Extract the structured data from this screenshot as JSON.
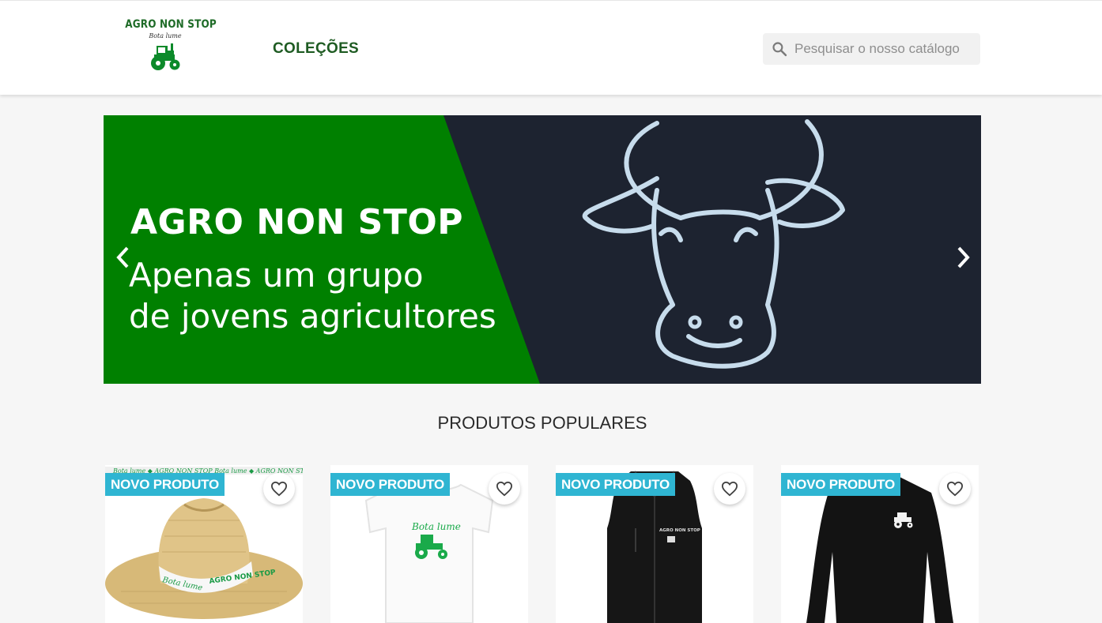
{
  "header": {
    "logo": {
      "title": "AGRO NON STOP",
      "subtitle": "Bota lume"
    },
    "nav": [
      {
        "label": "COLEÇÕES"
      }
    ],
    "search": {
      "placeholder": "Pesquisar o nosso catálogo",
      "value": ""
    }
  },
  "banner": {
    "title": "AGRO NON STOP",
    "line1": "Apenas um grupo",
    "line2": "de jovens agricultores",
    "colors": {
      "green": "#008000",
      "dark": "#1d2330"
    }
  },
  "popular": {
    "title": "PRODUTOS POPULARES",
    "products": [
      {
        "badge": "NOVO PRODUTO",
        "image": "straw-hat",
        "band_text": "Bota lume  AGRO NON STOP"
      },
      {
        "badge": "NOVO PRODUTO",
        "image": "white-t-shirt",
        "print_text": "Bota lume"
      },
      {
        "badge": "NOVO PRODUTO",
        "image": "black-vest",
        "print_text": "AGRO NON STOP"
      },
      {
        "badge": "NOVO PRODUTO",
        "image": "black-sweatshirt"
      }
    ]
  },
  "icons": {
    "search": "search-icon",
    "prev": "chevron-left-icon",
    "next": "chevron-right-icon",
    "wishlist": "heart-outline-icon"
  },
  "colors": {
    "badge": "#2fb5d2",
    "brand_green": "#1e5b22"
  }
}
